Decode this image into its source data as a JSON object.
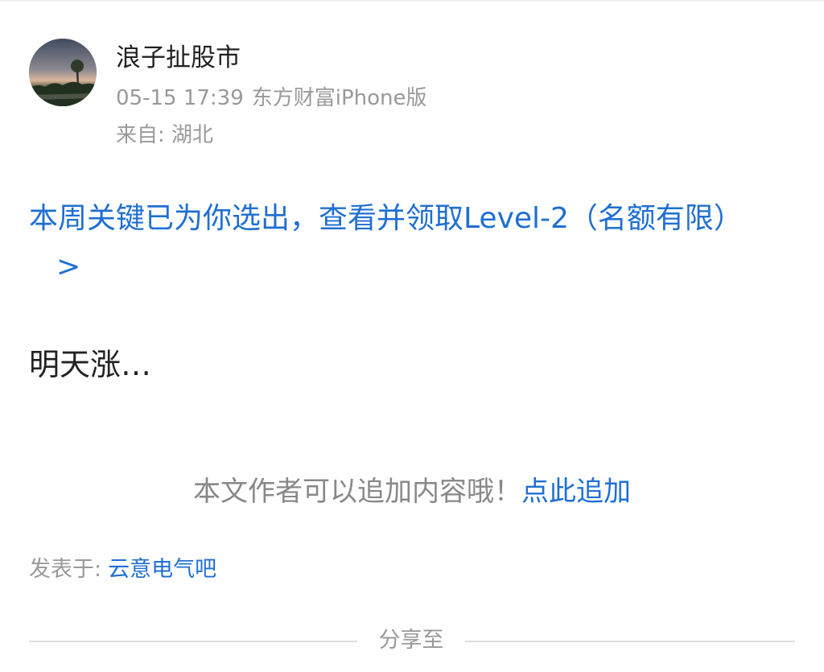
{
  "post": {
    "author": "浪子扯股市",
    "date": "05-15 17:39",
    "source": "东方财富iPhone版",
    "location": "来自: 湖北",
    "promo_text": "本周关键已为你选出，查看并领取Level-2（名额有限）",
    "promo_arrow": ">",
    "content": "明天涨…",
    "append_hint": "本文作者可以追加内容哦！",
    "append_link": "点此追加",
    "posted_in_label": "发表于:",
    "bar_name": "云意电气吧"
  },
  "share": {
    "label": "分享至"
  },
  "colors": {
    "link": "#1f6fd1",
    "muted": "#999999",
    "text": "#222222"
  }
}
